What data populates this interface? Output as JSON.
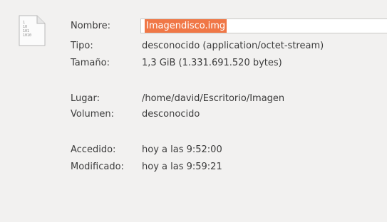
{
  "file": {
    "icon": "binary-file-icon",
    "icon_text": "1\n10\n101\n1010"
  },
  "properties": {
    "name_label": "Nombre:",
    "name_value": "Imagendisco.img",
    "type_label": "Tipo:",
    "type_value": "desconocido (application/octet-stream)",
    "size_label": "Tamaño:",
    "size_value": "1,3 GiB (1.331.691.520 bytes)",
    "location_label": "Lugar:",
    "location_value": "/home/david/Escritorio/Imagen",
    "volume_label": "Volumen:",
    "volume_value": "desconocido",
    "accessed_label": "Accedido:",
    "accessed_value": "hoy a las 9:52:00",
    "modified_label": "Modificado:",
    "modified_value": "hoy a las 9:59:21"
  },
  "colors": {
    "background": "#f2f1f0",
    "selection": "#f07746",
    "text": "#3c3c3c"
  }
}
